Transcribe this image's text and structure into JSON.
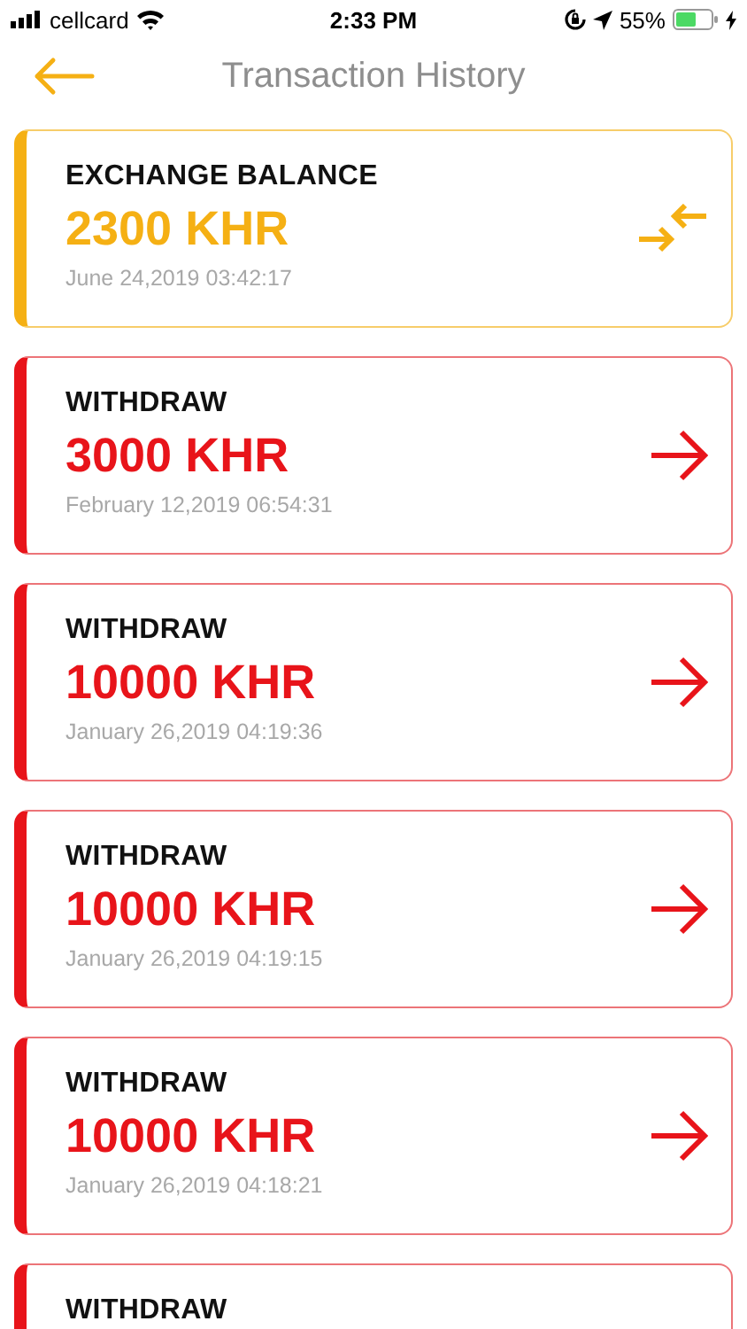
{
  "status_bar": {
    "carrier": "cellcard",
    "time": "2:33 PM",
    "battery": "55%"
  },
  "header": {
    "title": "Transaction History"
  },
  "transactions": [
    {
      "kind": "exchange",
      "title": "EXCHANGE BALANCE",
      "amount": "2300 KHR",
      "date": "June 24,2019 03:42:17"
    },
    {
      "kind": "withdraw",
      "title": "WITHDRAW",
      "amount": "3000 KHR",
      "date": "February 12,2019 06:54:31"
    },
    {
      "kind": "withdraw",
      "title": "WITHDRAW",
      "amount": "10000 KHR",
      "date": "January 26,2019 04:19:36"
    },
    {
      "kind": "withdraw",
      "title": "WITHDRAW",
      "amount": "10000 KHR",
      "date": "January 26,2019 04:19:15"
    },
    {
      "kind": "withdraw",
      "title": "WITHDRAW",
      "amount": "10000 KHR",
      "date": "January 26,2019 04:18:21"
    },
    {
      "kind": "withdraw",
      "title": "WITHDRAW"
    }
  ]
}
